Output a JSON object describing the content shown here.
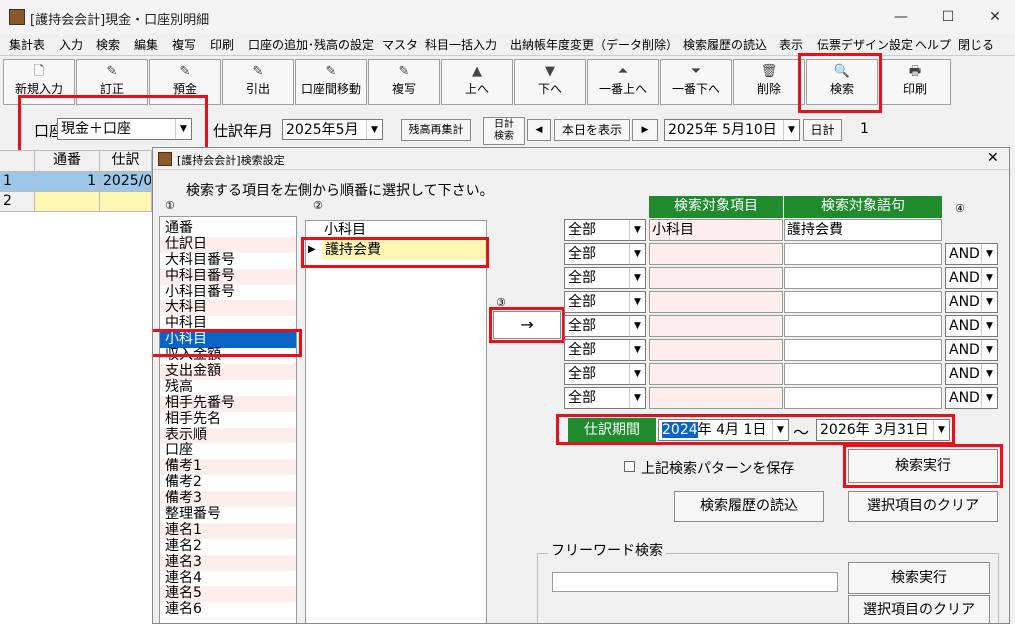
{
  "window": {
    "title": "[護持会会計]現金・口座別明細",
    "minimize": "—",
    "maximize": "☐",
    "close": "✕"
  },
  "menu": [
    "集計表",
    "入力",
    "検索",
    "編集",
    "複写",
    "印刷",
    "口座の追加･残高の設定",
    "マスタ",
    "科目一括入力",
    "出納帳年度変更（データ削除）",
    "検索履歴の読込",
    "表示",
    "伝票デザイン設定",
    "ヘルプ",
    "閉じる"
  ],
  "toolbar": {
    "new": "新規入力",
    "edit": "訂正",
    "deposit": "預金",
    "withdraw": "引出",
    "transfer": "口座間移動",
    "copy": "複写",
    "up": "上へ",
    "down": "下へ",
    "top": "一番上へ",
    "bottom": "一番下へ",
    "delete": "削除",
    "search": "検索",
    "print": "印刷"
  },
  "filterbar": {
    "account_label": "口座",
    "account_value": "現金＋口座",
    "period_label": "仕訳年月",
    "period_value": "2025年5月",
    "recalc": "残高再集計",
    "daily_label_1": "日計",
    "daily_label_2": "検索",
    "prev": "◀",
    "today": "本日を表示",
    "next": "▶",
    "date_value": "2025年  5月10日",
    "daily": "日計",
    "count": "1"
  },
  "grid": {
    "headers": [
      "通番",
      "仕訳"
    ],
    "rows": [
      {
        "num": "1",
        "seq": "1",
        "date": "2025/0"
      },
      {
        "num": "2",
        "seq": "",
        "date": ""
      }
    ]
  },
  "dialog": {
    "title": "[護持会会計]検索設定",
    "close": "✕",
    "instruction": "検索する項目を左側から順番に選択して下さい。",
    "step1": "①",
    "step2": "②",
    "step3": "③",
    "step4": "④",
    "fields": [
      "通番",
      "仕訳日",
      "大科目番号",
      "中科目番号",
      "小科目番号",
      "大科目",
      "中科目",
      "小科目",
      "収入金額",
      "支出金額",
      "残高",
      "相手先番号",
      "相手先名",
      "表示順",
      "口座",
      "備考1",
      "備考2",
      "備考3",
      "整理番号",
      "連名1",
      "連名2",
      "連名3",
      "連名4",
      "連名5",
      "連名6"
    ],
    "selected_field_index": 7,
    "subitem_header": "小科目",
    "subitem_row": "護持会費",
    "subitem_pointer": "▶",
    "arrow_button": "→",
    "col_item": "検索対象項目",
    "col_term": "検索対象語句",
    "conditions": [
      {
        "mode": "全部",
        "item": "小科目",
        "term": "護持会費",
        "logic": ""
      },
      {
        "mode": "全部",
        "item": "",
        "term": "",
        "logic": "AND"
      },
      {
        "mode": "全部",
        "item": "",
        "term": "",
        "logic": "AND"
      },
      {
        "mode": "全部",
        "item": "",
        "term": "",
        "logic": "AND"
      },
      {
        "mode": "全部",
        "item": "",
        "term": "",
        "logic": "AND"
      },
      {
        "mode": "全部",
        "item": "",
        "term": "",
        "logic": "AND"
      },
      {
        "mode": "全部",
        "item": "",
        "term": "",
        "logic": "AND"
      },
      {
        "mode": "全部",
        "item": "",
        "term": "",
        "logic": "AND"
      }
    ],
    "period_label": "仕訳期間",
    "period_from_year": "2024",
    "period_from_rest": "年  4月  1日",
    "period_tilde": "〜",
    "period_to": "2026年  3月31日",
    "save_pattern": "上記検索パターンを保存",
    "run": "検索実行",
    "load_history": "検索履歴の読込",
    "clear": "選択項目のクリア",
    "freeword_title": "フリーワード検索",
    "freeword_value": "",
    "freeword_run": "検索実行",
    "freeword_clear": "選択項目のクリア"
  },
  "colors": {
    "accent_green": "#1f8b2c",
    "highlight_red": "#e8101a",
    "selection_blue": "#0a64c8",
    "row_pink": "#fdeeed",
    "cell_yellow": "#fdf6b3"
  }
}
